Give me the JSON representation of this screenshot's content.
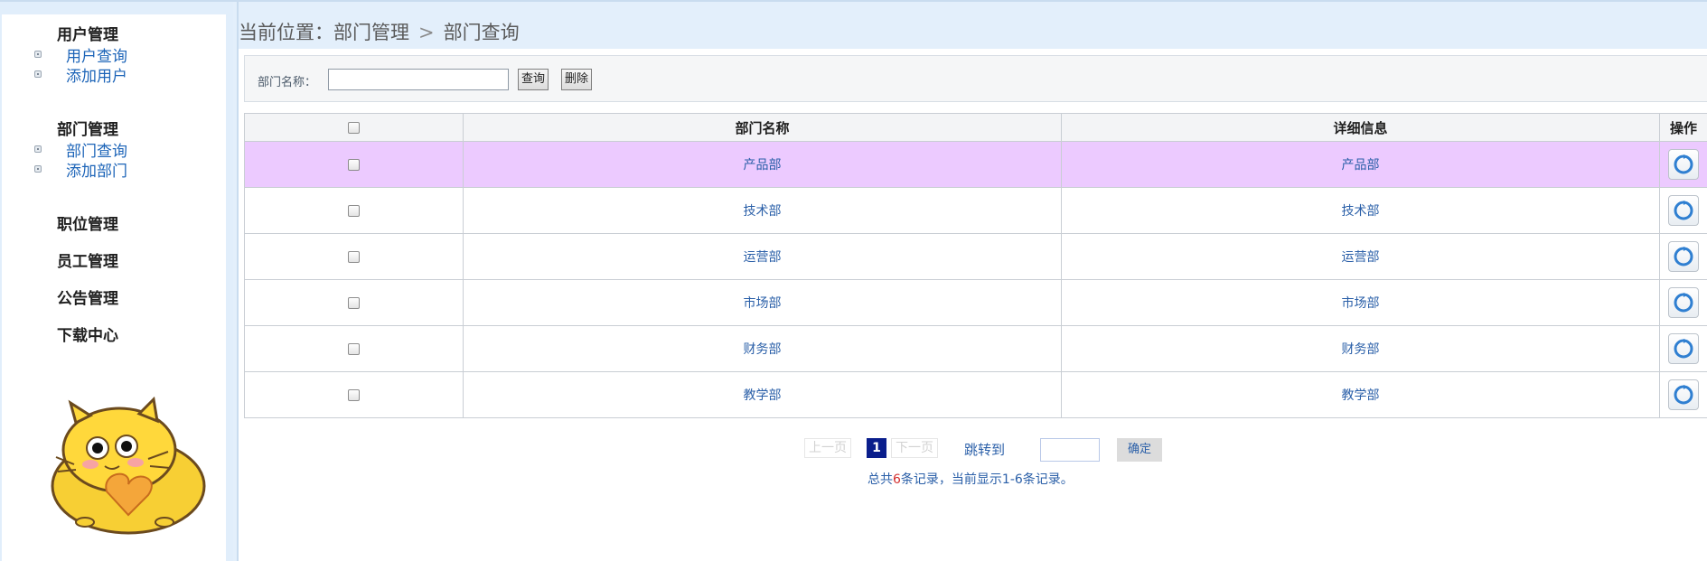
{
  "sidebar": {
    "groups": [
      {
        "title": "用户管理",
        "items": [
          "用户查询",
          "添加用户"
        ]
      },
      {
        "title": "部门管理",
        "items": [
          "部门查询",
          "添加部门"
        ]
      },
      {
        "title": "职位管理",
        "items": []
      },
      {
        "title": "员工管理",
        "items": []
      },
      {
        "title": "公告管理",
        "items": []
      },
      {
        "title": "下载中心",
        "items": []
      }
    ]
  },
  "breadcrumb": {
    "prefix": "当前位置：",
    "parts": [
      "部门管理",
      "部门查询"
    ],
    "separator": ">"
  },
  "search": {
    "label": "部门名称：",
    "value": "",
    "query_label": "查询",
    "delete_label": "删除"
  },
  "table": {
    "headers": [
      "",
      "部门名称",
      "详细信息",
      "操作"
    ],
    "rows": [
      {
        "name": "产品部",
        "detail": "产品部",
        "highlight": true
      },
      {
        "name": "技术部",
        "detail": "技术部",
        "highlight": false
      },
      {
        "name": "运营部",
        "detail": "运营部",
        "highlight": false
      },
      {
        "name": "市场部",
        "detail": "市场部",
        "highlight": false
      },
      {
        "name": "财务部",
        "detail": "财务部",
        "highlight": false
      },
      {
        "name": "教学部",
        "detail": "教学部",
        "highlight": false
      }
    ],
    "operation_icon": "edit-refresh-icon"
  },
  "pager": {
    "prev_label": "上一页",
    "current_page": "1",
    "next_label": "下一页",
    "jump_label": "跳转到",
    "jump_value": "",
    "confirm_label": "确定"
  },
  "summary": {
    "before": "总共",
    "total": "6",
    "after": "条记录，当前显示1-6条记录。"
  },
  "colors": {
    "accent_link": "#2a5fa8",
    "highlight_row": "#eccaff",
    "current_page_bg": "#0a1e8c",
    "panel_bg": "#e3effb"
  }
}
